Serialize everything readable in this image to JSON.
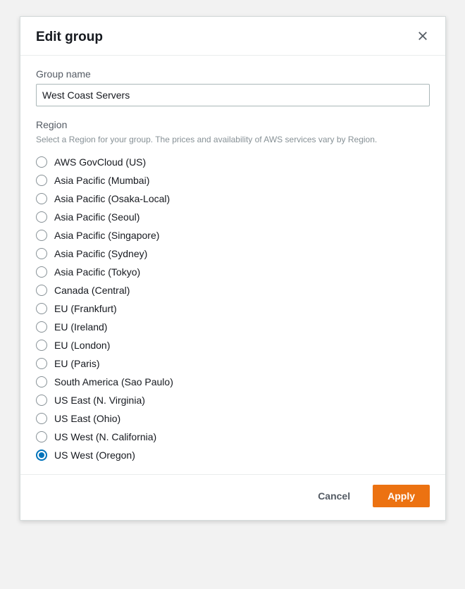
{
  "dialog": {
    "title": "Edit group",
    "group_name_label": "Group name",
    "group_name_value": "West Coast Servers",
    "region_label": "Region",
    "region_helper": "Select a Region for your group. The prices and availability of AWS services vary by Region.",
    "regions": [
      {
        "label": "AWS GovCloud (US)",
        "selected": false
      },
      {
        "label": "Asia Pacific (Mumbai)",
        "selected": false
      },
      {
        "label": "Asia Pacific (Osaka-Local)",
        "selected": false
      },
      {
        "label": "Asia Pacific (Seoul)",
        "selected": false
      },
      {
        "label": "Asia Pacific (Singapore)",
        "selected": false
      },
      {
        "label": "Asia Pacific (Sydney)",
        "selected": false
      },
      {
        "label": "Asia Pacific (Tokyo)",
        "selected": false
      },
      {
        "label": "Canada (Central)",
        "selected": false
      },
      {
        "label": "EU (Frankfurt)",
        "selected": false
      },
      {
        "label": "EU (Ireland)",
        "selected": false
      },
      {
        "label": "EU (London)",
        "selected": false
      },
      {
        "label": "EU (Paris)",
        "selected": false
      },
      {
        "label": "South America (Sao Paulo)",
        "selected": false
      },
      {
        "label": "US East (N. Virginia)",
        "selected": false
      },
      {
        "label": "US East (Ohio)",
        "selected": false
      },
      {
        "label": "US West (N. California)",
        "selected": false
      },
      {
        "label": "US West (Oregon)",
        "selected": true
      }
    ],
    "cancel_label": "Cancel",
    "apply_label": "Apply"
  }
}
